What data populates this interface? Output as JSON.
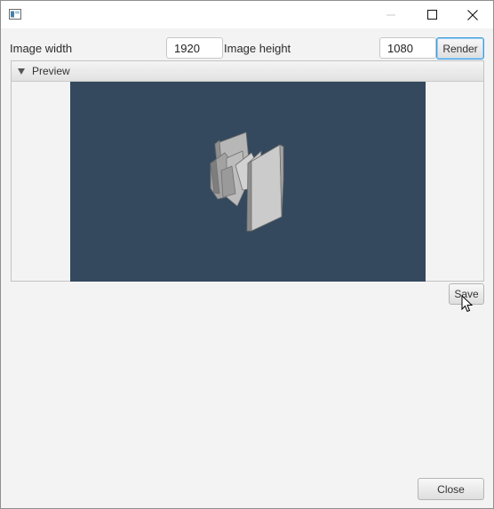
{
  "window": {
    "title_icon": "window-app-icon",
    "controls": {
      "minimize": "minimize-icon",
      "maximize": "maximize-icon",
      "close": "close-icon"
    }
  },
  "settings": {
    "width_label": "Image width",
    "width_value": "1920",
    "height_label": "Image height",
    "height_value": "1080",
    "render_label": "Render"
  },
  "preview": {
    "title": "Preview",
    "background": "#34495e"
  },
  "actions": {
    "save_label": "Save",
    "close_label": "Close"
  },
  "colors": {
    "accent_focus": "#3d9be0"
  }
}
